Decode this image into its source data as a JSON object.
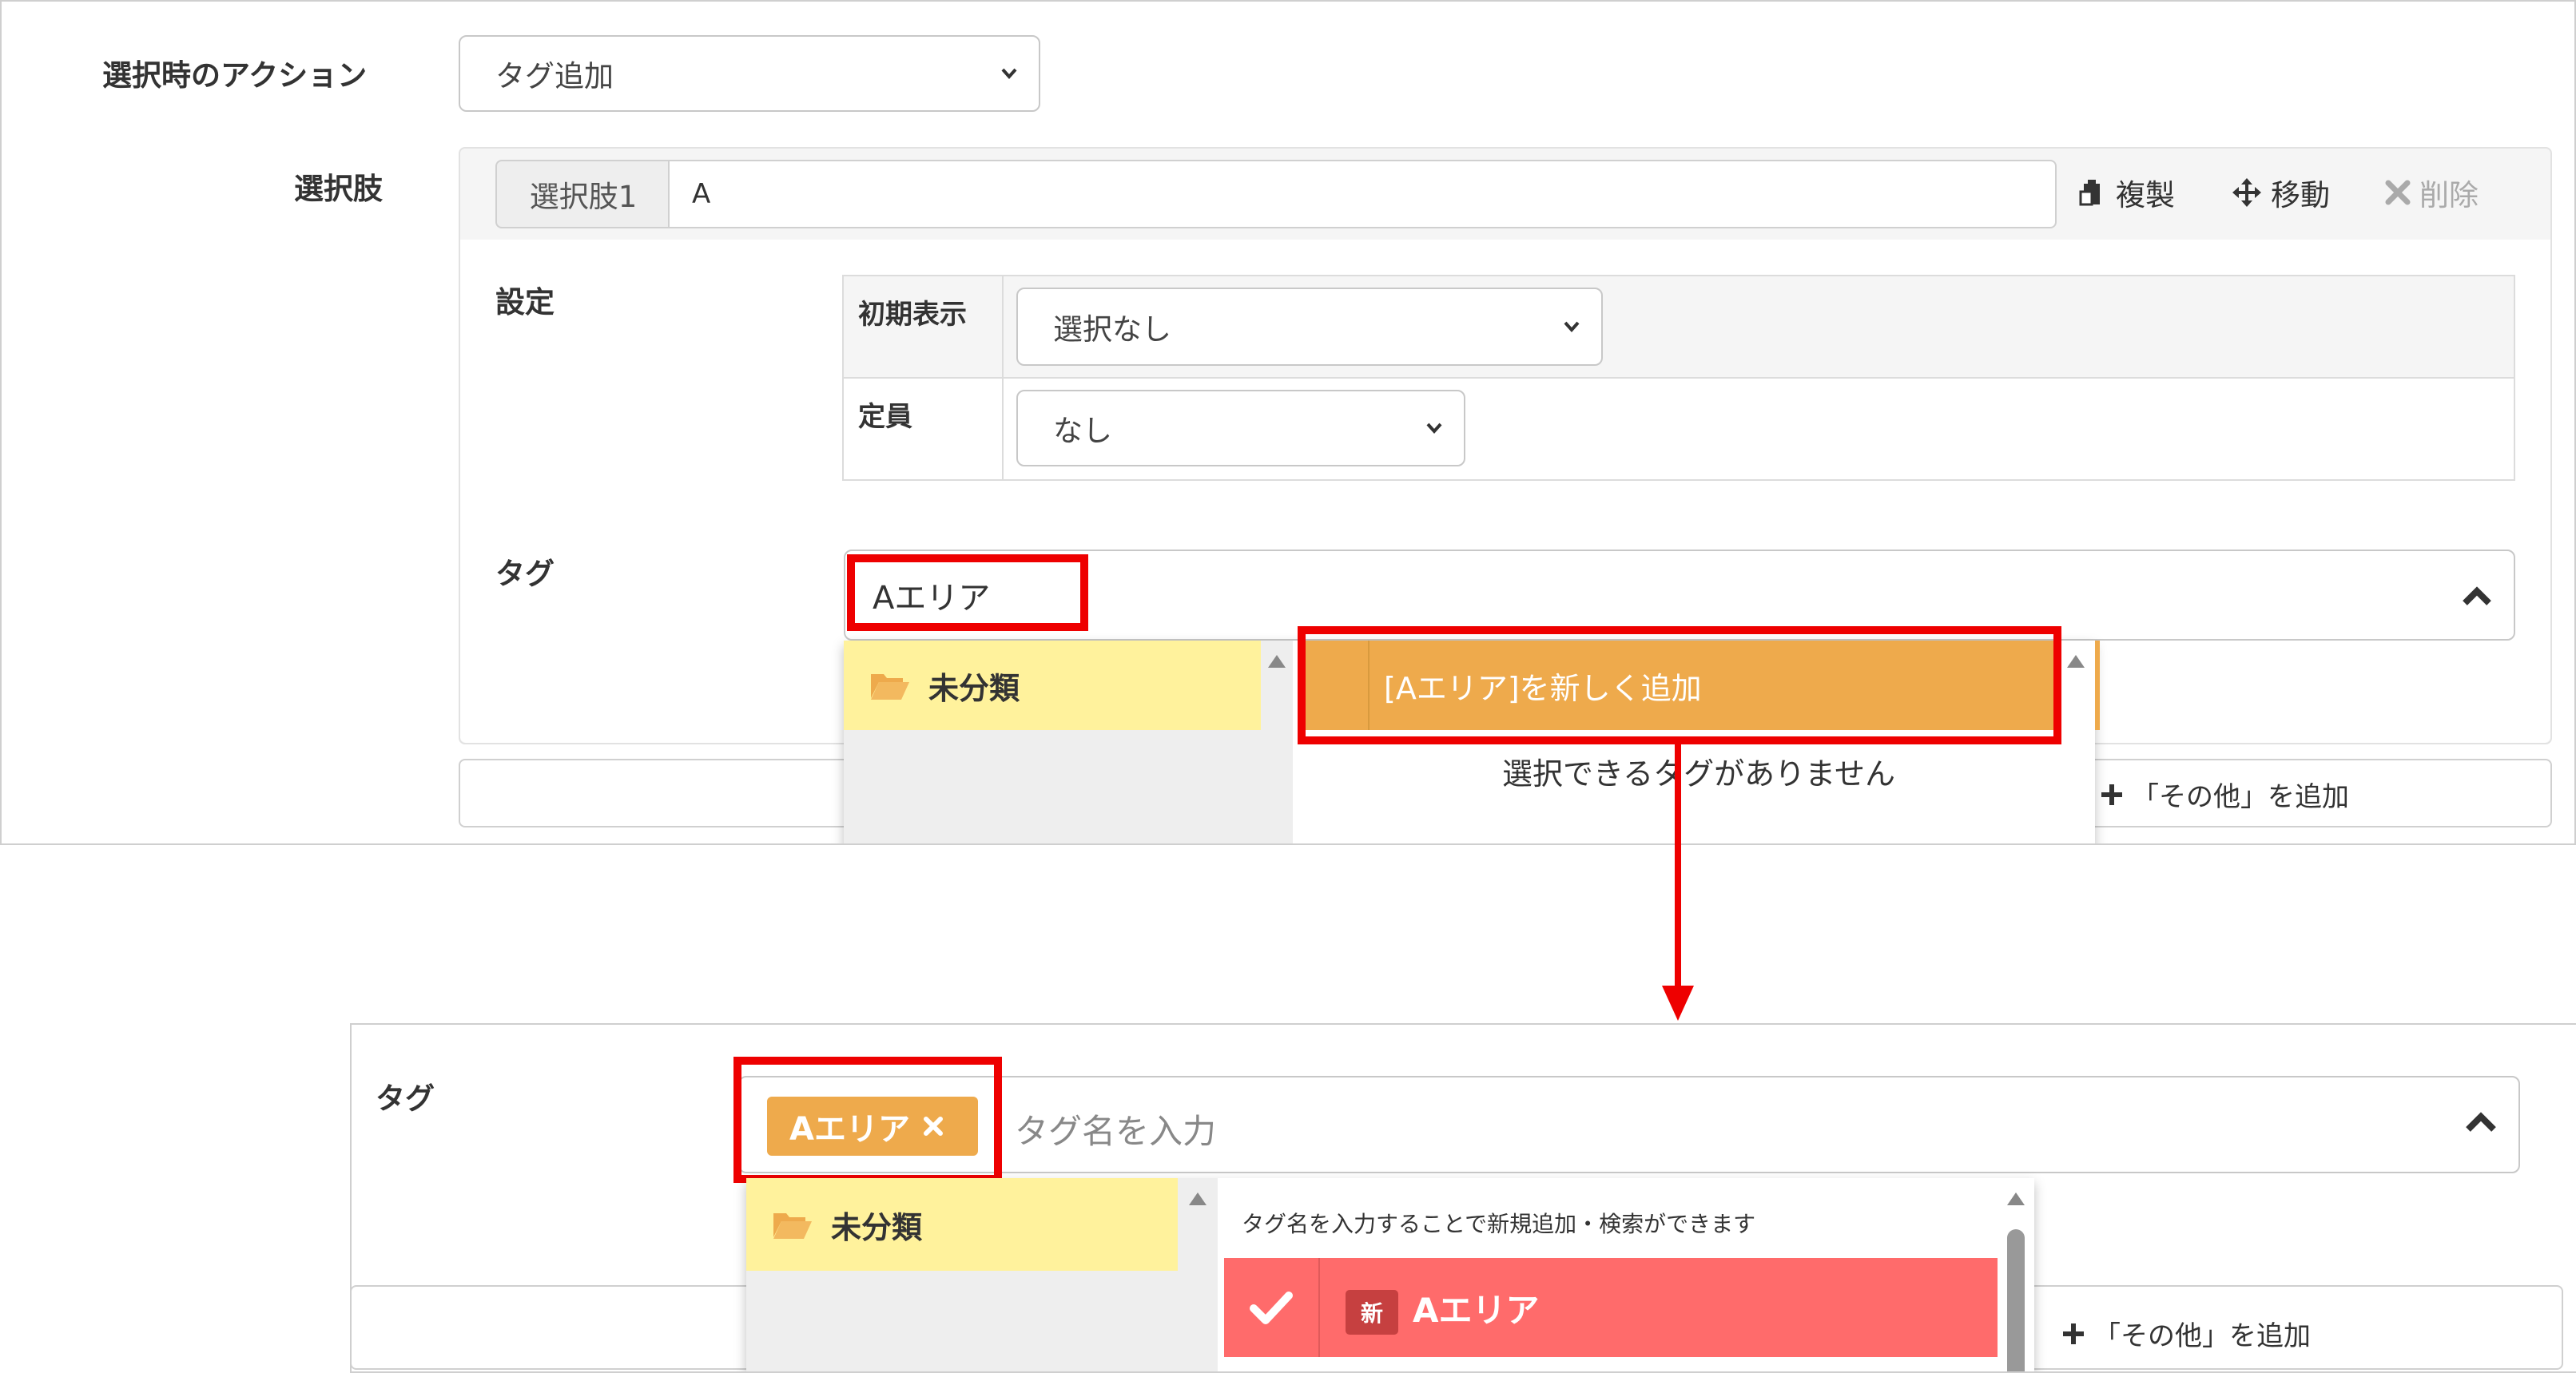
{
  "top_form": {
    "action_label": "選択時のアクション",
    "action_value": "タグ追加",
    "choices_label": "選択肢",
    "choice_addon": "選択肢1",
    "choice_value": "A",
    "copy_label": "複製",
    "move_label": "移動",
    "delete_label": "削除",
    "settings_label": "設定",
    "initial_display_label": "初期表示",
    "initial_display_value": "選択なし",
    "capacity_label": "定員",
    "capacity_value": "なし",
    "tag_label": "タグ",
    "tag_input_value": "Aエリア",
    "category_label": "未分類",
    "add_new_option": "[Aエリア]を新しく追加",
    "no_tags_message": "選択できるタグがありません",
    "add_other_label": "「その他」を追加"
  },
  "bottom_form": {
    "tag_label": "タグ",
    "selected_tag": "Aエリア",
    "tag_placeholder": "タグ名を入力",
    "category_label": "未分類",
    "hint_text": "タグ名を入力することで新規追加・検索ができます",
    "new_badge": "新",
    "new_tag_name": "Aエリア",
    "add_other_label": "「その他」を追加"
  },
  "colors": {
    "highlight_red": "#ee0000",
    "tag_orange": "#eeaa4c",
    "category_yellow": "#fff29c",
    "selected_row_red": "#ff6b6b"
  },
  "icons": [
    "chevron-down-icon",
    "paste-icon",
    "move-icon",
    "delete-x-icon",
    "chevron-up-icon",
    "folder-open-icon",
    "scroll-up-icon",
    "plus-icon",
    "check-icon",
    "chip-close-icon",
    "arrow-down-icon"
  ]
}
